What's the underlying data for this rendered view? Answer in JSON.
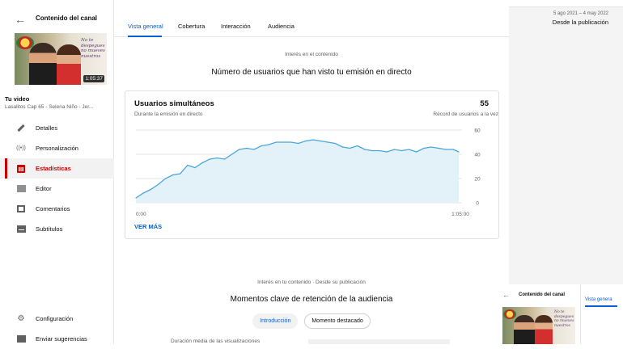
{
  "sidebar": {
    "back_icon": "arrow-left-icon",
    "title": "Contenido del canal",
    "video_thumb": {
      "duration": "1:05:37",
      "script_text": "No te\ndespegues\nno mueves\nnuestros"
    },
    "your_video_label": "Tu video",
    "video_name": "Lasalitos Cap 65 - Selena Niño - Jer...",
    "nav": [
      {
        "label": "Detalles",
        "icon": "pencil-icon"
      },
      {
        "label": "Personalización",
        "icon": "broadcast-icon"
      },
      {
        "label": "Estadísticas",
        "icon": "analytics-icon"
      },
      {
        "label": "Editor",
        "icon": "editor-icon"
      },
      {
        "label": "Comentarios",
        "icon": "comments-icon"
      },
      {
        "label": "Subtítulos",
        "icon": "subtitles-icon"
      }
    ],
    "bottom": [
      {
        "label": "Configuración",
        "icon": "gear-icon"
      },
      {
        "label": "Enviar sugerencias",
        "icon": "feedback-icon"
      }
    ]
  },
  "tabs": [
    "Vista general",
    "Cobertura",
    "Interacción",
    "Audiencia"
  ],
  "active_tab": "Vista general",
  "date_range": {
    "small": "5 ago 2021 – 4 may 2022",
    "main": "Desde la publicación"
  },
  "section1": {
    "kicker": "Interés en el contenido",
    "title": "Número de usuarios que han visto tu emisión en directo"
  },
  "card": {
    "title": "Usuarios simultáneos",
    "subtitle": "Durante la emisión en directo",
    "value": "55",
    "note": "Récord de usuarios a la vez",
    "link": "VER MÁS"
  },
  "chart_data": {
    "type": "area",
    "x_ticks": [
      "0:00",
      "1:05:00"
    ],
    "y_ticks": [
      0,
      20,
      40,
      60
    ],
    "ylim": [
      0,
      60
    ],
    "x_minutes": [
      0,
      1.5,
      3,
      4.5,
      6,
      7.5,
      9,
      10.5,
      12,
      13.5,
      15,
      16.5,
      18,
      19.5,
      21,
      22.5,
      24,
      25.5,
      27,
      28.5,
      30,
      31.5,
      33,
      34.5,
      36,
      37.5,
      39,
      40.5,
      42,
      43.5,
      45,
      46.5,
      48,
      49.5,
      51,
      52.5,
      54,
      55.5,
      57,
      58.5,
      60,
      61.5,
      63,
      64.5,
      65.6
    ],
    "values": [
      4,
      8,
      11,
      15,
      20,
      23,
      24,
      31,
      29,
      33,
      36,
      37,
      36,
      40,
      44,
      45,
      44,
      47,
      48,
      50,
      50,
      50,
      49,
      51,
      52,
      51,
      50,
      49,
      46,
      45,
      47,
      44,
      43,
      43,
      42,
      44,
      43,
      44,
      42,
      45,
      46,
      45,
      44,
      44,
      42
    ],
    "color": "#4ba6d8",
    "fill": "#e3f1f9",
    "grid": true
  },
  "section2": {
    "kicker": "Interés en tu contenido · Desde su publicación",
    "title": "Momentos clave de retención de la audiencia"
  },
  "pills": [
    {
      "label": "Introducción",
      "selected": true
    },
    {
      "label": "Momento destacado",
      "selected": false
    }
  ],
  "cut_row": {
    "text": "Duración media de las visualizaciones"
  },
  "mini": {
    "title": "Contenido del canal",
    "tab": "Vista genera",
    "script_text": "No te\ndespegues\nno mueves\nnuestros"
  },
  "colors": {
    "accent_blue": "#065fd4",
    "accent_red": "#cc0000"
  }
}
